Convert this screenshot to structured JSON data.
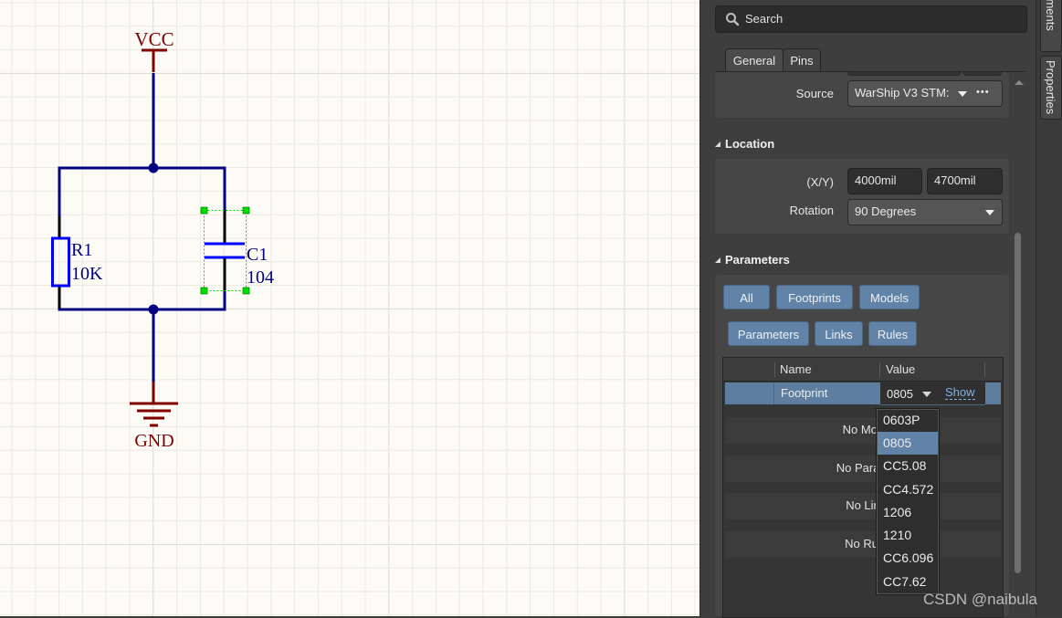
{
  "schematic": {
    "power_port": {
      "label": "VCC"
    },
    "ground_port": {
      "label": "GND"
    },
    "resistor": {
      "designator": "R1",
      "value": "10K"
    },
    "capacitor": {
      "designator": "C1",
      "value": "104"
    },
    "colors": {
      "wire": "#000080",
      "power": "#800000",
      "body": "#0000ff",
      "selection": "#00e000",
      "grid": "#ece9e2",
      "grid_major": "#dcdad4",
      "background": "#fdfbf6"
    }
  },
  "panel": {
    "search": {
      "placeholder": "Search",
      "icon": "search-icon"
    },
    "tabs": [
      {
        "label": "General",
        "active": true
      },
      {
        "label": "Pins",
        "active": false
      }
    ],
    "general": {
      "source_label": "Source",
      "source_value": "WarShip V3 STM:",
      "more_label": "•••"
    },
    "location": {
      "title": "Location",
      "xy_label": "(X/Y)",
      "x_value": "4000mil",
      "y_value": "4700mil",
      "rotation_label": "Rotation",
      "rotation_value": "90 Degrees"
    },
    "parameters": {
      "title": "Parameters",
      "filter_buttons": [
        "All",
        "Footprints",
        "Models",
        "Parameters",
        "Links",
        "Rules"
      ],
      "columns": [
        "Name",
        "Value"
      ],
      "selected_row": {
        "name": "Footprint",
        "value": "0805",
        "action": "Show"
      },
      "empty_rows": [
        "No Models",
        "No Parameters",
        "No Links",
        "No Rules"
      ],
      "empty_rows_visible": [
        "No Moc",
        "No Param",
        "No Lin",
        "No Rul"
      ],
      "dropdown_options": [
        "0603P",
        "0805",
        "CC5.08",
        "CC4.572",
        "1206",
        "1210",
        "CC6.096",
        "CC7.62"
      ],
      "dropdown_selected": "0805"
    }
  },
  "side_tabs": [
    {
      "label": "Comments"
    },
    {
      "label": "Properties"
    }
  ],
  "watermark": "CSDN @naibula",
  "accent": "#6283a8"
}
